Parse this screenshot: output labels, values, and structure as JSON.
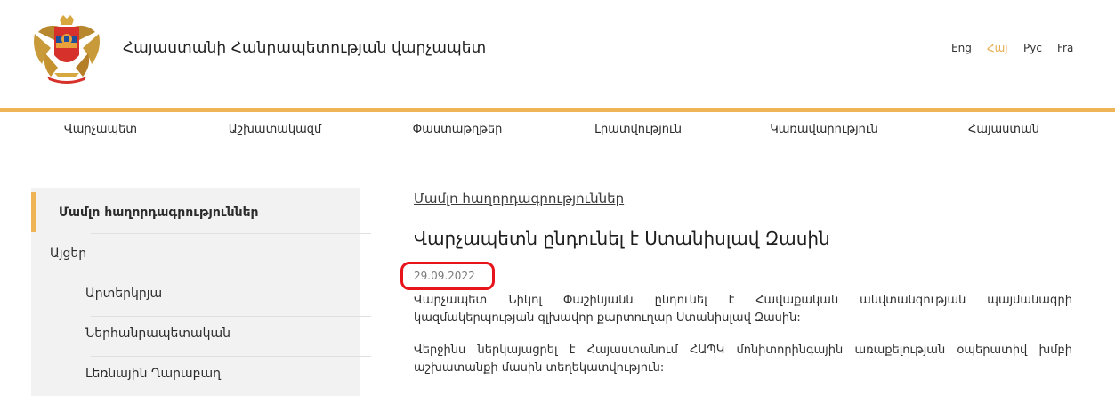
{
  "header": {
    "site_title": "Հայաստանի Հանրապետության վարչապետ",
    "languages": [
      {
        "label": "Eng",
        "active": false
      },
      {
        "label": "Հայ",
        "active": true
      },
      {
        "label": "Рус",
        "active": false
      },
      {
        "label": "Fra",
        "active": false
      }
    ]
  },
  "colors": {
    "accent": "#efb456",
    "highlight": "#e8141b",
    "active_language": "#e8ac4d"
  },
  "icons": {
    "logo": "coat-of-arms-icon"
  },
  "nav": {
    "items": [
      {
        "label": "Վարչապետ"
      },
      {
        "label": "Աշխատակազմ"
      },
      {
        "label": "Փաստաթղթեր"
      },
      {
        "label": "Լրատվություն"
      },
      {
        "label": "Կառավարություն"
      },
      {
        "label": "Հայաստան"
      }
    ]
  },
  "sidebar": {
    "items": [
      {
        "label": "Մամլո հաղորդագրություններ",
        "active": true
      },
      {
        "label": "Այցեր",
        "active": false
      },
      {
        "label": "Արտերկրյա",
        "active": false
      },
      {
        "label": "Ներհանրապետական",
        "active": false
      },
      {
        "label": "Լեռնային Ղարաբաղ",
        "active": false
      }
    ]
  },
  "main": {
    "breadcrumb": "Մամլո հաղորդագրություններ",
    "title": "Վարչապետն ընդունել է Ստանիսլավ Զասին",
    "date": "29.09.2022",
    "paragraphs": [
      "Վարչապետ Նիկոլ Փաշինյանն ընդունել է Հավաքական անվտանգության պայմանագրի կազմակերպության գլխավոր քարտուղար Ստանիսլավ Զասին:",
      "Վերջինս ներկայացրել է Հայաստանում ՀԱՊԿ մոնիտորինգային առաքելության օպերատիվ խմբի աշխատանքի մասին տեղեկատվություն:"
    ]
  }
}
